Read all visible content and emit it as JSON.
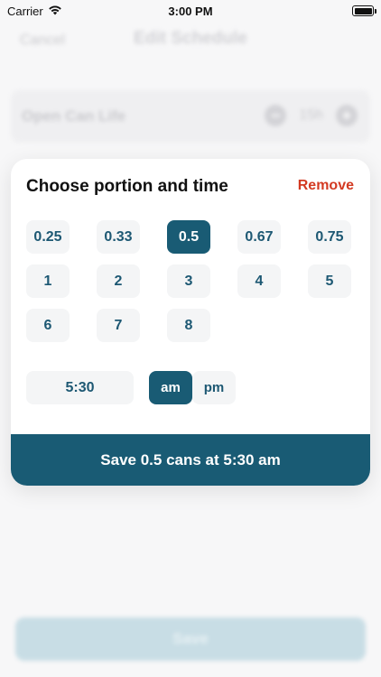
{
  "status_bar": {
    "carrier": "Carrier",
    "time": "3:00 PM"
  },
  "background": {
    "cancel_label": "Cancel",
    "title": "Edit Schedule",
    "open_can_life_label": "Open Can Life",
    "open_can_life_value": "15h",
    "save_label": "Save"
  },
  "sheet": {
    "title": "Choose portion and time",
    "remove_label": "Remove",
    "portions": [
      "0.25",
      "0.33",
      "0.5",
      "0.67",
      "0.75",
      "1",
      "2",
      "3",
      "4",
      "5",
      "6",
      "7",
      "8"
    ],
    "selected_portion": "0.5",
    "time_value": "5:30",
    "am_label": "am",
    "pm_label": "pm",
    "selected_period": "am",
    "save_button_label": "Save 0.5 cans at 5:30 am"
  },
  "colors": {
    "accent": "#195b74",
    "destructive": "#d33a22"
  }
}
